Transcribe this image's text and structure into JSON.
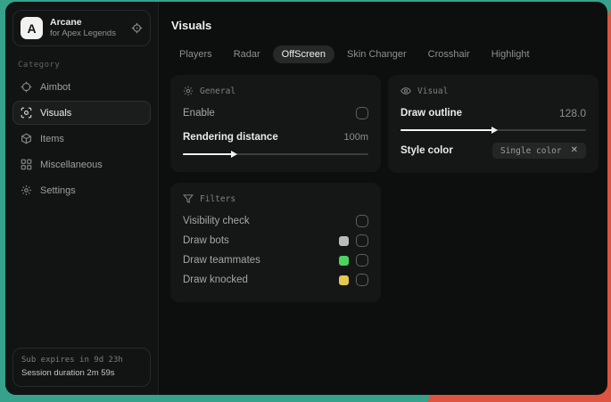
{
  "background": {
    "teal": "#36a28c",
    "orange": "#dd5440"
  },
  "sidebar": {
    "app": {
      "logo_letter": "A",
      "name": "Arcane",
      "subtitle": "for Apex Legends"
    },
    "category_label": "Category",
    "items": [
      {
        "label": "Aimbot",
        "icon": "crosshair-icon",
        "selected": false
      },
      {
        "label": "Visuals",
        "icon": "eye-scan-icon",
        "selected": true
      },
      {
        "label": "Items",
        "icon": "box-icon",
        "selected": false
      },
      {
        "label": "Miscellaneous",
        "icon": "grid-icon",
        "selected": false
      },
      {
        "label": "Settings",
        "icon": "gear-icon",
        "selected": false
      }
    ],
    "footer": {
      "line1": "Sub expires in 9d 23h",
      "line2": "Session duration 2m 59s"
    }
  },
  "header": {
    "title": "Visuals"
  },
  "tabs": [
    {
      "label": "Players",
      "selected": false
    },
    {
      "label": "Radar",
      "selected": false
    },
    {
      "label": "OffScreen",
      "selected": true
    },
    {
      "label": "Skin Changer",
      "selected": false
    },
    {
      "label": "Crosshair",
      "selected": false
    },
    {
      "label": "Highlight",
      "selected": false
    }
  ],
  "panels": {
    "general": {
      "title": "General",
      "enable_label": "Enable",
      "enable_checked": false,
      "rendering_distance_label": "Rendering distance",
      "rendering_distance_value": "100m",
      "rendering_distance_percent": 27
    },
    "visual": {
      "title": "Visual",
      "draw_outline_label": "Draw outline",
      "draw_outline_value": "128.0",
      "draw_outline_percent": 50,
      "style_color_label": "Style color",
      "style_color_value": "Single color"
    },
    "filters": {
      "title": "Filters",
      "rows": [
        {
          "label": "Visibility check",
          "swatch": null,
          "checked": false
        },
        {
          "label": "Draw bots",
          "swatch": "#b9bcba",
          "checked": false
        },
        {
          "label": "Draw teammates",
          "swatch": "#4bd55f",
          "checked": false
        },
        {
          "label": "Draw knocked",
          "swatch": "#e5c84f",
          "checked": false
        }
      ]
    }
  }
}
